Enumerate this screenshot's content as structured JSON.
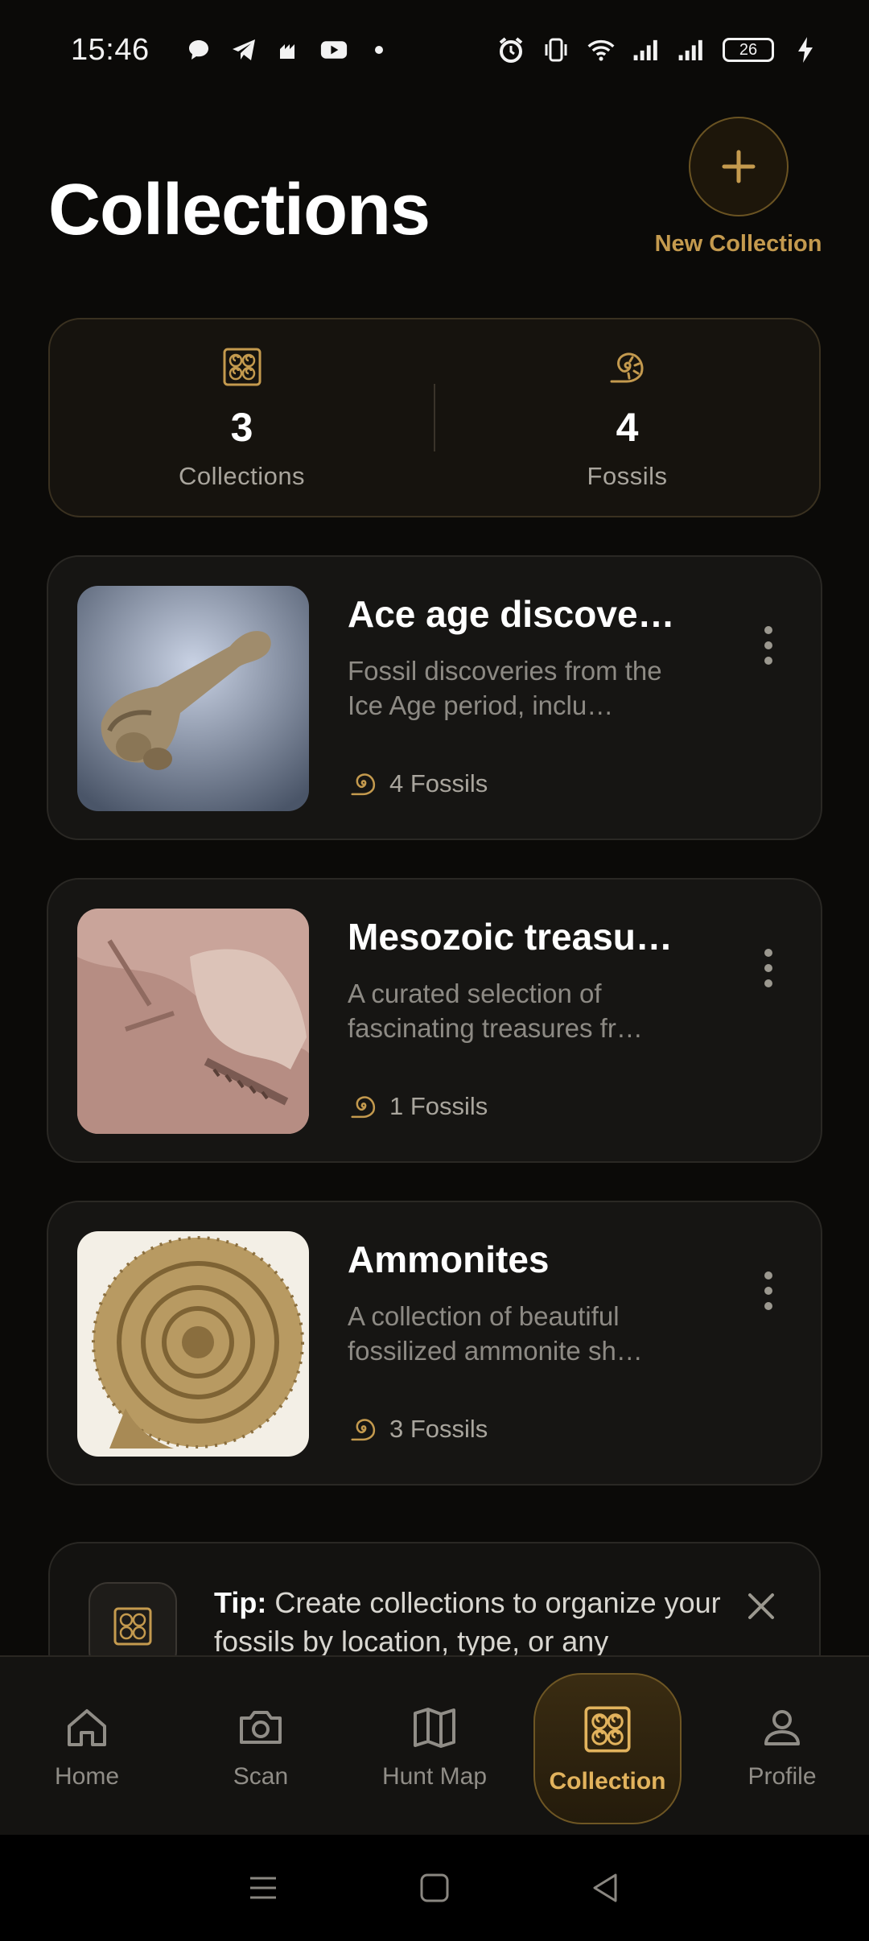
{
  "status_bar": {
    "time": "15:46",
    "battery": "26",
    "icons": [
      "chat-bubble-icon",
      "telegram-icon",
      "app-icon",
      "youtube-icon",
      "dot-icon",
      "alarm-icon",
      "vibrate-icon",
      "wifi-icon",
      "signal-icon",
      "signal-icon",
      "battery-icon",
      "charging-icon"
    ]
  },
  "header": {
    "title": "Collections",
    "new_collection_label": "New Collection"
  },
  "stats": {
    "collections_value": "3",
    "collections_label": "Collections",
    "fossils_value": "4",
    "fossils_label": "Fossils"
  },
  "collections": [
    {
      "title": "Ace age discover…",
      "description": "Fossil discoveries from the Ice Age period, inclu…",
      "count": "4 Fossils"
    },
    {
      "title": "Mesozoic treasur…",
      "description": "A curated selection of fascinating treasures fr…",
      "count": "1 Fossils"
    },
    {
      "title": "Ammonites",
      "description": "A collection of beautiful fossilized ammonite sh…",
      "count": "3 Fossils"
    }
  ],
  "tip": {
    "prefix": "Tip:",
    "text": " Create collections to organize your fossils by location, type, or any"
  },
  "nav": {
    "home": "Home",
    "scan": "Scan",
    "hunt_map": "Hunt Map",
    "collection": "Collection",
    "profile": "Profile",
    "active": "collection"
  },
  "colors": {
    "accent": "#c49a4e",
    "background": "#0b0a08",
    "card": "#161513"
  }
}
